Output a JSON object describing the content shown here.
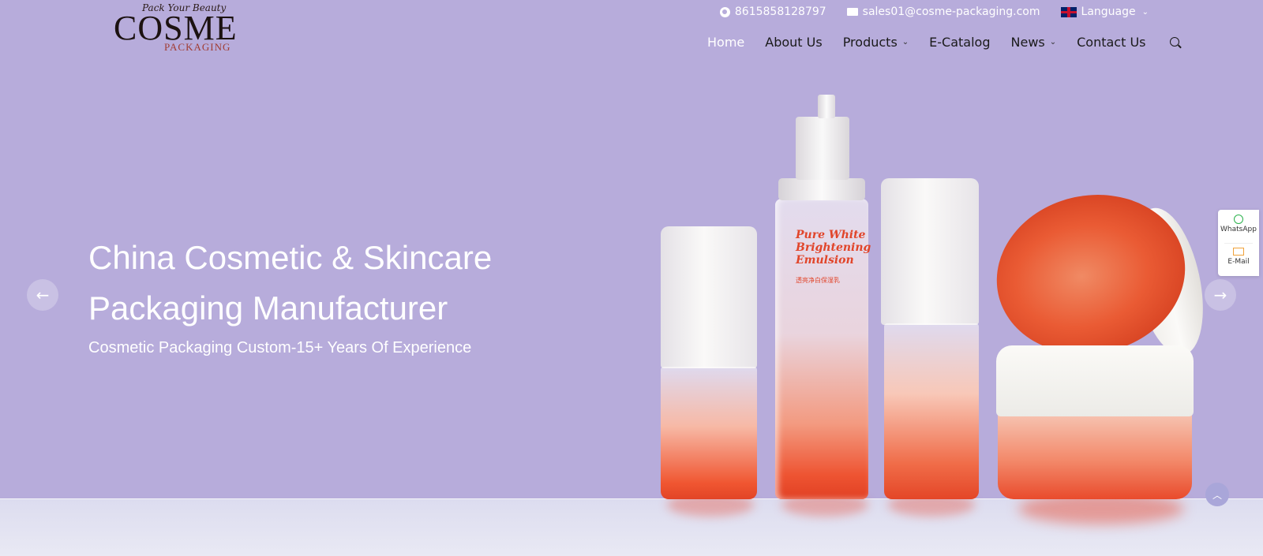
{
  "logo": {
    "tagline": "Pack Your Beauty",
    "name": "COSME",
    "sub": "PACKAGING"
  },
  "contact": {
    "phone": "8615858128797",
    "email": "sales01@cosme-packaging.com",
    "language_label": "Language"
  },
  "nav": {
    "items": [
      {
        "label": "Home",
        "active": true
      },
      {
        "label": "About Us"
      },
      {
        "label": "Products",
        "dropdown": true
      },
      {
        "label": "E-Catalog"
      },
      {
        "label": "News",
        "dropdown": true
      },
      {
        "label": "Contact Us"
      }
    ]
  },
  "hero": {
    "title_line1": "China Cosmetic & Skincare",
    "title_line2": "Packaging Manufacturer",
    "subtitle": "Cosmetic Packaging Custom-15+ Years Of Experience"
  },
  "product_label": {
    "line1": "Pure White",
    "line2": "Brightening",
    "line3": "Emulsion",
    "cn": "透亮净白保湿乳"
  },
  "side_widget": {
    "whatsapp": "WhatsApp",
    "email": "E-Mail"
  },
  "icons": {
    "prev": "arrow-left-icon",
    "next": "arrow-right-icon",
    "search": "search-icon",
    "totop": "chevron-up-icon"
  },
  "colors": {
    "hero_bg": "#b7acdb",
    "accent_orange": "#ea5b34",
    "whatsapp_green": "#2bb24c"
  }
}
